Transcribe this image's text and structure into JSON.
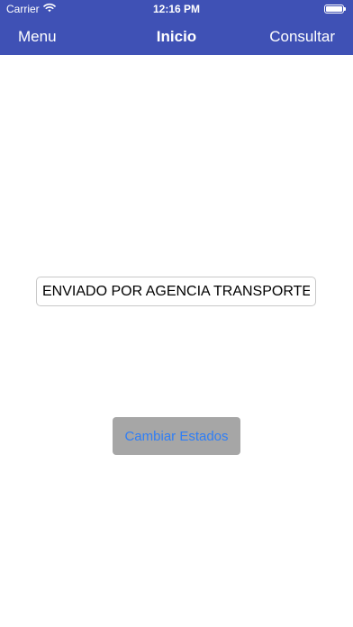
{
  "status_bar": {
    "carrier": "Carrier",
    "time": "12:16 PM",
    "wifi_icon": "wifi-icon",
    "battery_icon": "battery-icon",
    "battery_level": 1.0
  },
  "nav": {
    "left_label": "Menu",
    "title": "Inicio",
    "right_label": "Consultar",
    "background_color": "#3f51b5",
    "text_color": "#ffffff"
  },
  "main": {
    "status_field_value": "ENVIADO POR AGENCIA TRANSPORTE",
    "action_button_label": "Cambiar Estados",
    "action_button_color": "#a6a6a6",
    "action_button_text_color": "#2f7ef6"
  }
}
